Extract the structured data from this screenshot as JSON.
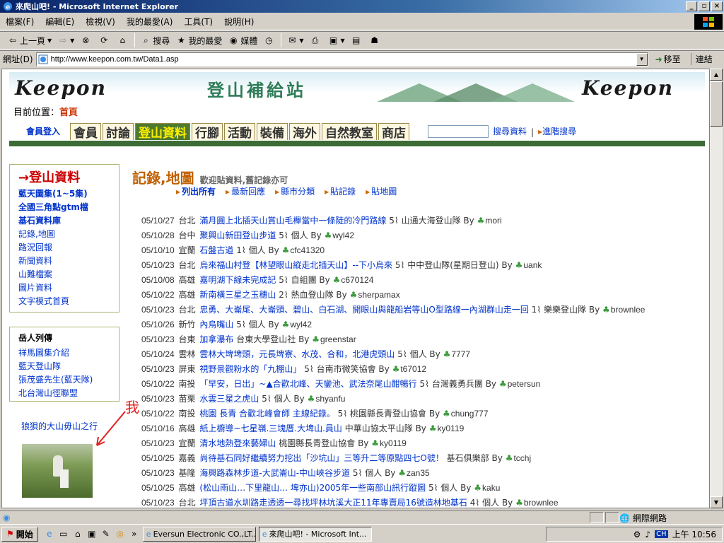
{
  "window": {
    "title": "來爬山吧! - Microsoft Internet Explorer"
  },
  "menu": [
    "檔案(F)",
    "編輯(E)",
    "檢視(V)",
    "我的最愛(A)",
    "工具(T)",
    "說明(H)"
  ],
  "toolbar": {
    "back": "上一頁",
    "search": "搜尋",
    "favorites": "我的最愛",
    "media": "媒體"
  },
  "address": {
    "label": "網址(D)",
    "url": "http://www.keepon.com.tw/Data1.asp",
    "go": "移至",
    "links": "連結"
  },
  "banner": {
    "logo": "Keepon",
    "title": "登山補給站"
  },
  "location": {
    "label": "目前位置：",
    "current": "首頁"
  },
  "nav": {
    "login": "會員登入",
    "tabs": [
      "會員",
      "討論",
      "登山資料",
      "行腳",
      "活動",
      "裝備",
      "海外",
      "自然教室",
      "商店"
    ],
    "search_link": "搜尋資料",
    "advanced_link": "進階搜尋"
  },
  "sidebar": {
    "heading": "→登山資料",
    "items": [
      "藍天圖集(1~5集)",
      "全國三角點gtm檔",
      "基石資料庫",
      "記錄,地圖",
      "路況回報",
      "新聞資料",
      "山難檔案",
      "圖片資料",
      "文字模式首頁"
    ],
    "box2_heading": "岳人列傳",
    "box2_items": [
      "祥馬圖集介紹",
      "藍天登山隊",
      "張茂盛先生(藍天隊)",
      "北台灣山徑聯盟"
    ]
  },
  "annotation": {
    "me": "我",
    "trip": "狼狽的大山毋山之行"
  },
  "main": {
    "title": "記錄,地圖",
    "subtitle": "歡迎貼資料,舊記錄亦可",
    "subnav": [
      "列出所有",
      "最新回應",
      "縣市分類",
      "貼記錄",
      "貼地圖"
    ]
  },
  "posts": [
    {
      "date": "05/10/27",
      "region": "台北",
      "title": "滿月圓上北插天山賞山毛櫸當中一條陡的冷門路線",
      "count": "5",
      "group": "山通大海登山隊",
      "user": "mori"
    },
    {
      "date": "05/10/28",
      "region": "台中",
      "title": "聚興山新田登山步道",
      "count": "5",
      "group": "個人",
      "user": "wyl42"
    },
    {
      "date": "05/10/10",
      "region": "宜蘭",
      "title": "石盤古道",
      "count": "1",
      "group": "個人",
      "user": "cfc41320"
    },
    {
      "date": "05/10/23",
      "region": "台北",
      "title": "烏來福山村登【林望眼山縱走北插天山】--下小烏來",
      "count": "5",
      "group": "中中登山隊(星期日登山)",
      "user": "uank"
    },
    {
      "date": "05/10/08",
      "region": "高雄",
      "title": "嘉明湖下線未完成記",
      "count": "5",
      "group": "自組團",
      "user": "c670124"
    },
    {
      "date": "05/10/22",
      "region": "高雄",
      "title": "新南橫三星之玉穗山",
      "count": "2",
      "group": "熱血登山隊",
      "user": "sherpamax"
    },
    {
      "date": "05/10/23",
      "region": "台北",
      "title": "忠勇、大崙尾、大崙頭、碧山、白石湖、開眼山與龍船岩等山O型路線一內湖群山走一回",
      "count": "1",
      "group": "樂樂登山隊",
      "user": "brownlee"
    },
    {
      "date": "05/10/26",
      "region": "新竹",
      "title": "內烏嘴山",
      "count": "5",
      "group": "個人",
      "user": "wyl42"
    },
    {
      "date": "05/10/23",
      "region": "台東",
      "title": "加拿瀑布",
      "count": "",
      "group": "台東大學登山社",
      "user": "greenstar"
    },
    {
      "date": "05/10/24",
      "region": "雲林",
      "title": "雲林大埤埤頭，元長埤寮、水茂、合和，北港虎頭山",
      "count": "5",
      "group": "個人",
      "user": "7777"
    },
    {
      "date": "05/10/23",
      "region": "屏東",
      "title": "視野景觀粉水的「九棚山」",
      "count": "5",
      "group": "台南市微笑協會",
      "user": "t67012"
    },
    {
      "date": "05/10/22",
      "region": "南投",
      "title": "「早安，日出」~▲合歡北峰、天鑾池、武法奈尾山酣暢行",
      "count": "5",
      "group": "台灣義勇兵團",
      "user": "petersun"
    },
    {
      "date": "05/10/23",
      "region": "苗栗",
      "title": "水雲三星之虎山",
      "count": "5",
      "group": "個人",
      "user": "shyanfu"
    },
    {
      "date": "05/10/22",
      "region": "南投",
      "title": "桃園 長青 合歡北峰會師 主線紀錄。",
      "count": "5",
      "group": "桃園縣長青登山協會",
      "user": "chung777"
    },
    {
      "date": "05/10/16",
      "region": "高雄",
      "title": "紙上櫥導~七星嶺.三塊厝.大埤山.員山",
      "count": "",
      "group": "中華山協太平山隊",
      "user": "ky0119"
    },
    {
      "date": "05/10/23",
      "region": "宜蘭",
      "title": "清水地熱登來藝婦山",
      "count": "",
      "group": "桃園縣長青登山協會",
      "user": "ky0119"
    },
    {
      "date": "05/10/25",
      "region": "嘉義",
      "title": "尚待基石同好繼續努力挖出「沙坑山」三等升二等原點四七O號！",
      "count": "",
      "group": "基石俱樂部",
      "user": "tcchj"
    },
    {
      "date": "05/10/23",
      "region": "基隆",
      "title": "海興路森林步道-大武崙山-中山峽谷步道",
      "count": "5",
      "group": "個人",
      "user": "zan35"
    },
    {
      "date": "05/10/25",
      "region": "高雄",
      "title": "(松山雨山…下里龍山… 埤亦山)2005年一些南部山訊行蹤圖",
      "count": "5",
      "group": "個人",
      "user": "kaku"
    },
    {
      "date": "05/10/23",
      "region": "台北",
      "title": "坪頂古道水圳路走透透一尋找坪林坑溪大正11年專賣局16號造林地基石",
      "count": "4",
      "group": "個人",
      "user": "brownlee"
    }
  ],
  "labels": {
    "by": "By"
  },
  "status": {
    "zone": "網際網路"
  },
  "taskbar": {
    "start": "開始",
    "tasks": [
      "Eversun Electronic CO.,LT...",
      "來爬山吧! - Microsoft Int..."
    ],
    "clock": "上午 10:56",
    "ime": "CH"
  }
}
